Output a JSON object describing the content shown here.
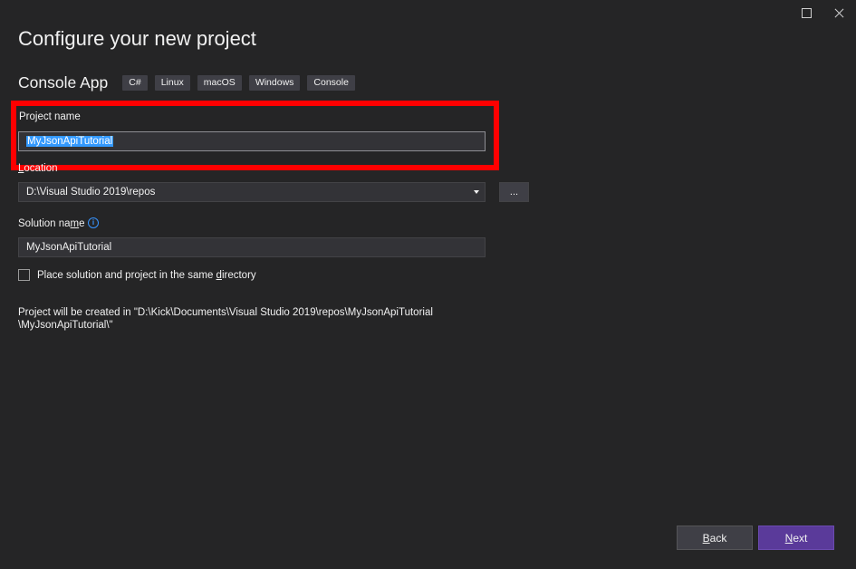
{
  "window": {
    "maximize_icon": "maximize-icon",
    "close_icon": "close-icon"
  },
  "page": {
    "title": "Configure your new project"
  },
  "template": {
    "name": "Console App",
    "tags": [
      "C#",
      "Linux",
      "macOS",
      "Windows",
      "Console"
    ]
  },
  "project_name": {
    "label": "Project name",
    "value": "MyJsonApiTutorial"
  },
  "location": {
    "label_prefix": "",
    "label_accel": "L",
    "label_rest": "ocation",
    "value": "D:\\Visual Studio 2019\\repos",
    "browse_label": "..."
  },
  "solution_name": {
    "label_prefix": "Solution na",
    "label_accel": "m",
    "label_rest": "e",
    "info_icon": "info-icon",
    "value": "MyJsonApiTutorial"
  },
  "same_directory": {
    "checked": false,
    "label_prefix": "Place solution and project in the same ",
    "label_accel": "d",
    "label_rest": "irectory"
  },
  "path_note": "Project will be created in \"D:\\Kick\\Documents\\Visual Studio 2019\\repos\\MyJsonApiTutorial\n\\MyJsonApiTutorial\\\"",
  "footer": {
    "back_accel": "B",
    "back_rest": "ack",
    "next_accel": "N",
    "next_rest": "ext"
  },
  "colors": {
    "background": "#252526",
    "highlight": "#ff0000",
    "selection": "#3399ff",
    "primary_button": "#5a3a9a"
  }
}
